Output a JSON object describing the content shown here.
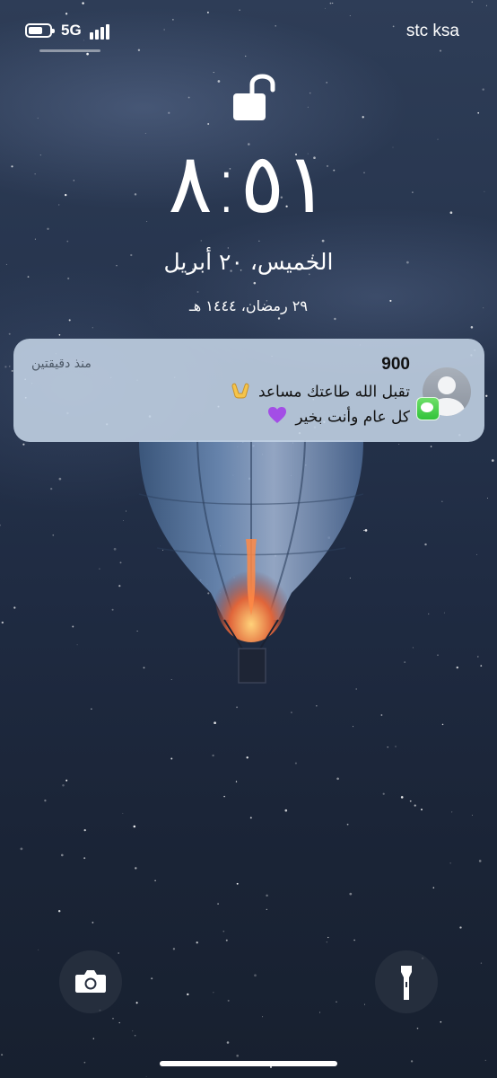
{
  "status_bar": {
    "network": "5G",
    "carrier": "stc ksa",
    "battery_level": 0.7,
    "signal_bars": 4
  },
  "lock_screen": {
    "time": "٨:٥١",
    "date": "الخميس، ٢٠ أبريل",
    "hijri_date": "٢٩ رمضان، ١٤٤٤ هـ"
  },
  "notification": {
    "sender": "900",
    "time_ago": "منذ دقيقتين",
    "line1": "تقبل الله طاعتك مساعد",
    "line1_emoji": "🤲",
    "line2": "كل عام وأنت بخير",
    "line2_emoji": "💜",
    "app_icon": "messages-icon",
    "avatar_icon": "contact-avatar-icon"
  },
  "quick_actions": {
    "camera_icon": "camera-icon",
    "flashlight_icon": "flashlight-icon"
  },
  "colors": {
    "notification_bg": "#c4d4e6",
    "messages_green": "#31c33a",
    "button_bg": "#283040"
  }
}
